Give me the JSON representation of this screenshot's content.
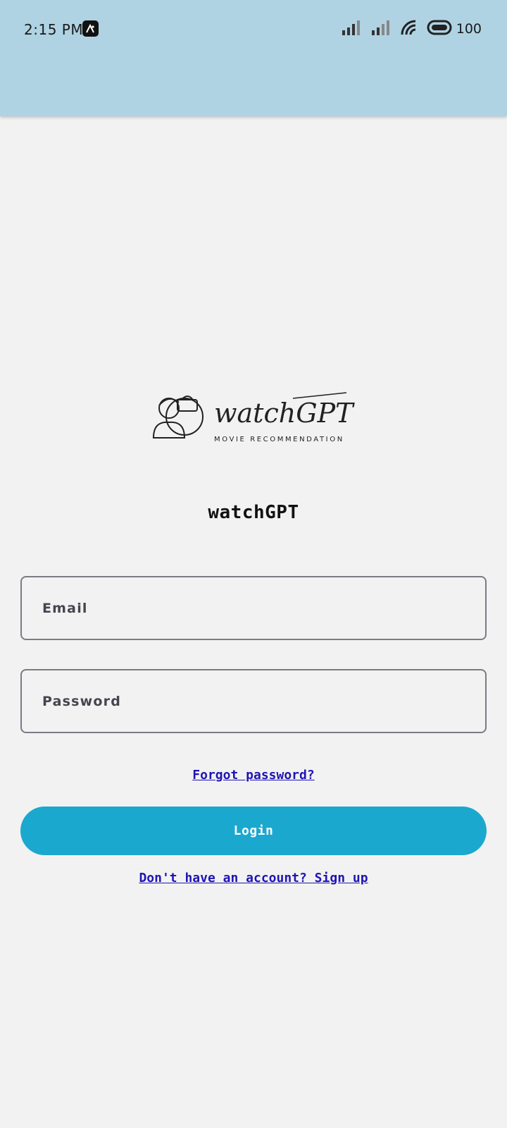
{
  "status_bar": {
    "time": "2:15 PM",
    "battery_level": "100",
    "icons": [
      "app-notification-icon",
      "signal-icon",
      "signal-icon",
      "wifi-icon",
      "battery-icon"
    ]
  },
  "logo": {
    "wordmark": "watchGPT",
    "tagline": "MOVIE RECOMMENDATION"
  },
  "app_title": "watchGPT",
  "form": {
    "email_placeholder": "Email",
    "password_placeholder": "Password",
    "forgot_password": "Forgot password?",
    "login_label": "Login",
    "signup_link": "Don't have an account? Sign up"
  },
  "colors": {
    "status_bar_bg": "#afd3e3",
    "page_bg": "#f2f2f2",
    "button_bg": "#1ba8cf",
    "link": "#1f14b4"
  }
}
